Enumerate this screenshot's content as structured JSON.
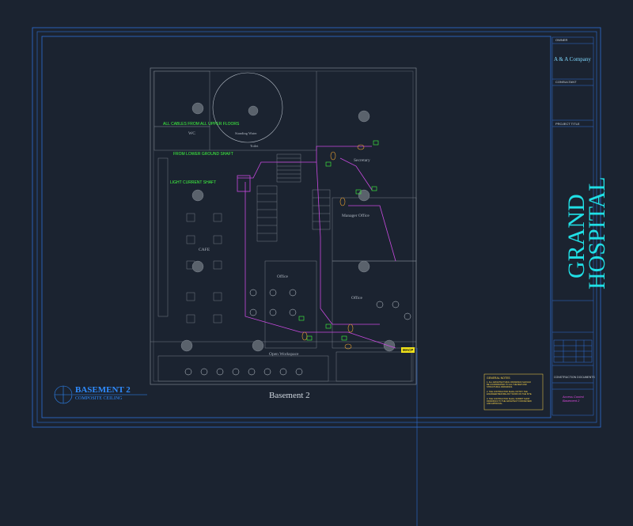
{
  "title_block": {
    "owner_header": "OWNER",
    "company": "A & A Company",
    "consultant_header": "CONSULTANT",
    "project_title_header": "PROJECT TITLE",
    "project_name_line1": "GRAND",
    "project_name_line2": "HOSPITAL",
    "phase": "CONSTRUCTION DOCUMENTS",
    "sheet_title_line1": "Access Control",
    "sheet_title_line2": "Basement 2"
  },
  "drawing": {
    "title": "BASEMENT 2",
    "subtitle": "COMPOSITE CEILING",
    "caption": "Basement 2"
  },
  "annotations": {
    "riser_1": "ALL CABLES FROM ALL UPPER FLOORS",
    "riser_2": "FROM LOWER GROUND SHAFT",
    "riser_3": "LIGHT CURRENT SHAFT"
  },
  "rooms": {
    "wc": "WC",
    "standing_water": "Standing Water",
    "toilet": "Toilet",
    "secretary": "Secretary",
    "manager_office": "Manager Office",
    "cafe": "CAFE",
    "office_1": "Office",
    "office_2": "Office",
    "open_workspace": "Open Workspace"
  },
  "equipment": {
    "macp": "MACP"
  },
  "general_notes": {
    "title": "GENERAL NOTES",
    "items": [
      "1. ALL ARCHITECTURAL DRAWINGS SHOULD BE COORDINATED TO ALL THE MEP AND STRUCTURAL DRAWINGS.",
      "2. THE CONTRACTOR SHALL NOTIFY THE ENGINEER BEFORE ANY WORK ON THE SITE.",
      "3. THE CONTRACTOR SHALL SUBMIT SHOP DRAWINGS TO THE ARCHITECT FOR REVIEW AND APPROVAL."
    ]
  },
  "colors": {
    "background": "#1b2330",
    "border_blue": "#2f6fd8",
    "cyan": "#20e0e6",
    "magenta": "#c94ae0",
    "green": "#40ff40",
    "yellow": "#f0e21a",
    "plan_lines": "#8a929c"
  }
}
